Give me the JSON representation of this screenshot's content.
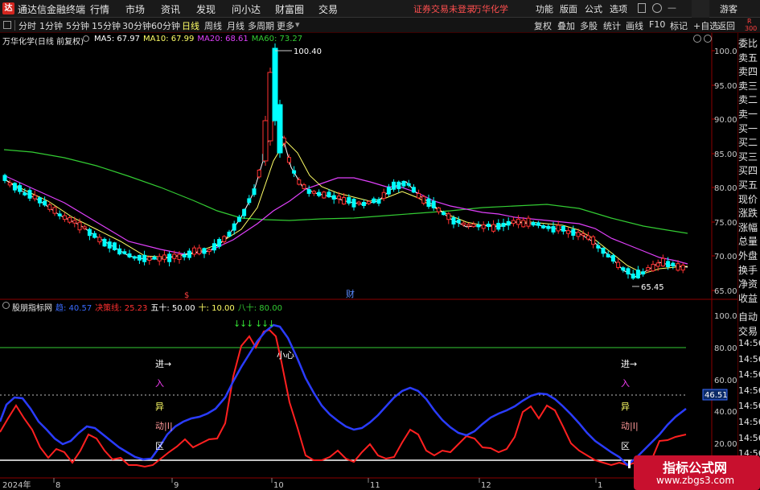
{
  "titlebar": {
    "app_name": "通达信金融终端",
    "logo_char": "达",
    "menus": [
      "行情",
      "市场",
      "资讯",
      "发现",
      "问小达",
      "财富圈",
      "交易"
    ],
    "login_status": "证券交易未登录",
    "stock_name": "万华化学",
    "right_menus": [
      "功能",
      "版面",
      "公式",
      "选项"
    ],
    "guest": "游客"
  },
  "toolbar": {
    "periods": [
      "分时",
      "1分钟",
      "5分钟",
      "15分钟",
      "30分钟",
      "60分钟",
      "日线",
      "周线",
      "月线",
      "多周期",
      "更多"
    ],
    "active_period": "日线",
    "right_items": [
      "复权",
      "叠加",
      "多股",
      "统计",
      "画线",
      "F10",
      "标记",
      "+自选",
      "返回"
    ]
  },
  "main_chart": {
    "title": "万华化学(日线 前复权)",
    "ma_labels": [
      {
        "text": "MA5: 67.97",
        "color": "#ffffff"
      },
      {
        "text": "MA10: 67.99",
        "color": "#ffff66"
      },
      {
        "text": "MA20: 68.61",
        "color": "#e040fb"
      },
      {
        "text": "MA60: 73.27",
        "color": "#33cc33"
      }
    ],
    "high_label": "100.40",
    "low_label": "65.45",
    "y_ticks": [
      "100.0",
      "95.00",
      "90.00",
      "85.00",
      "80.00",
      "75.00",
      "70.00",
      "65.00"
    ],
    "markers": [
      "$",
      "财"
    ]
  },
  "indicator": {
    "name": "股朋指标网",
    "labels": [
      {
        "text": "趋: 40.57",
        "color": "#3a6bff"
      },
      {
        "text": "决策线: 25.23",
        "color": "#ff3030"
      },
      {
        "text": "五十: 50.00",
        "color": "#ffffff"
      },
      {
        "text": "十: 10.00",
        "color": "#ffff66"
      },
      {
        "text": "八十: 80.00",
        "color": "#33cc33"
      }
    ],
    "y_ticks": [
      "100.0",
      "80.00",
      "60.00",
      "40.00",
      "20.00"
    ],
    "current_value": "46.51",
    "caution_text": "小心",
    "entry_chars": [
      "进→",
      "入",
      "异",
      "动|I|",
      "区"
    ]
  },
  "x_axis": [
    "2024年",
    "8",
    "9",
    "10",
    "11",
    "12",
    "1"
  ],
  "right_panel": {
    "top_label": "R",
    "top_value": "300",
    "items": [
      "委比",
      "卖五",
      "卖四",
      "卖三",
      "卖二",
      "卖一",
      "买一",
      "买二",
      "买三",
      "买四",
      "买五",
      "现价",
      "涨跌",
      "涨幅",
      "总量",
      "外盘",
      "换手",
      "净资",
      "收益"
    ],
    "lower_items": [
      "自动",
      "交易"
    ],
    "times": [
      "14:56",
      "14:56",
      "14:56",
      "14:56",
      "14:56",
      "14:56",
      "14:56",
      "14:56"
    ]
  },
  "watermark": {
    "line1": "指标公式网",
    "line2": "www.zbgs3.com"
  },
  "colors": {
    "up": "#ff3232",
    "down": "#00ffff",
    "ma5": "#ffffff",
    "ma10": "#ffff66",
    "ma20": "#e040fb",
    "ma60": "#33cc33",
    "trend": "#2a3cff",
    "decision": "#ff2020"
  }
}
